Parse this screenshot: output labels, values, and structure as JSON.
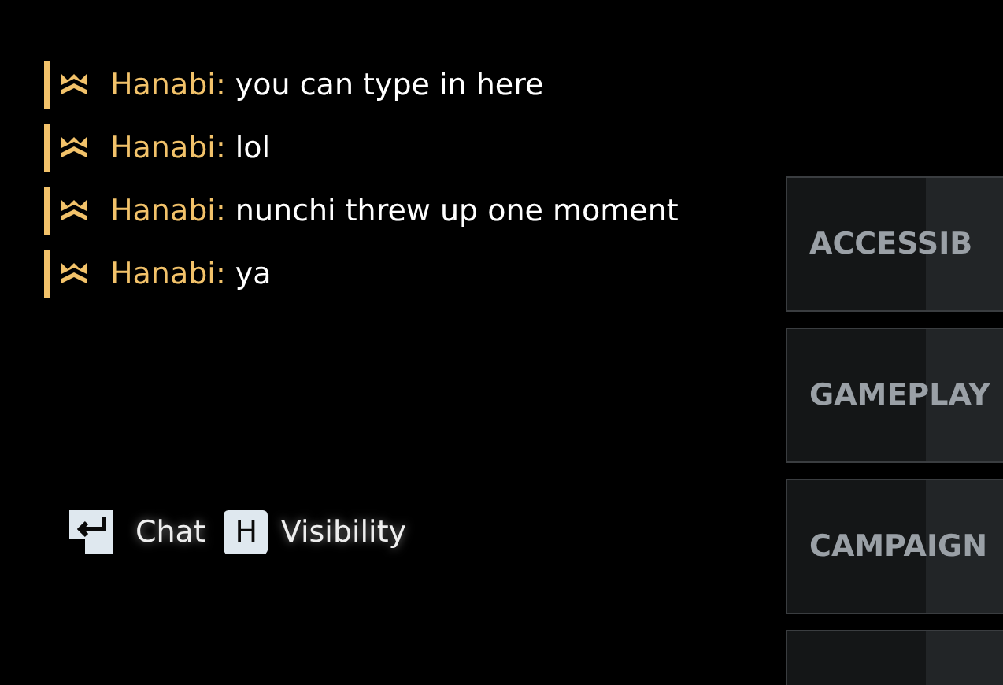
{
  "chat": {
    "messages": [
      {
        "sender": "Hanabi:",
        "text": "you can type in here"
      },
      {
        "sender": "Hanabi:",
        "text": "lol"
      },
      {
        "sender": "Hanabi:",
        "text": "nunchi threw up one moment"
      },
      {
        "sender": "Hanabi:",
        "text": "ya"
      }
    ],
    "hints": [
      {
        "kind": "enter",
        "label": "Chat"
      },
      {
        "kind": "key",
        "key": "H",
        "label": "Visibility"
      }
    ]
  },
  "menu": {
    "items": [
      {
        "label": "ACCESSIB"
      },
      {
        "label": "GAMEPLAY"
      },
      {
        "label": "CAMPAIGN"
      }
    ]
  }
}
